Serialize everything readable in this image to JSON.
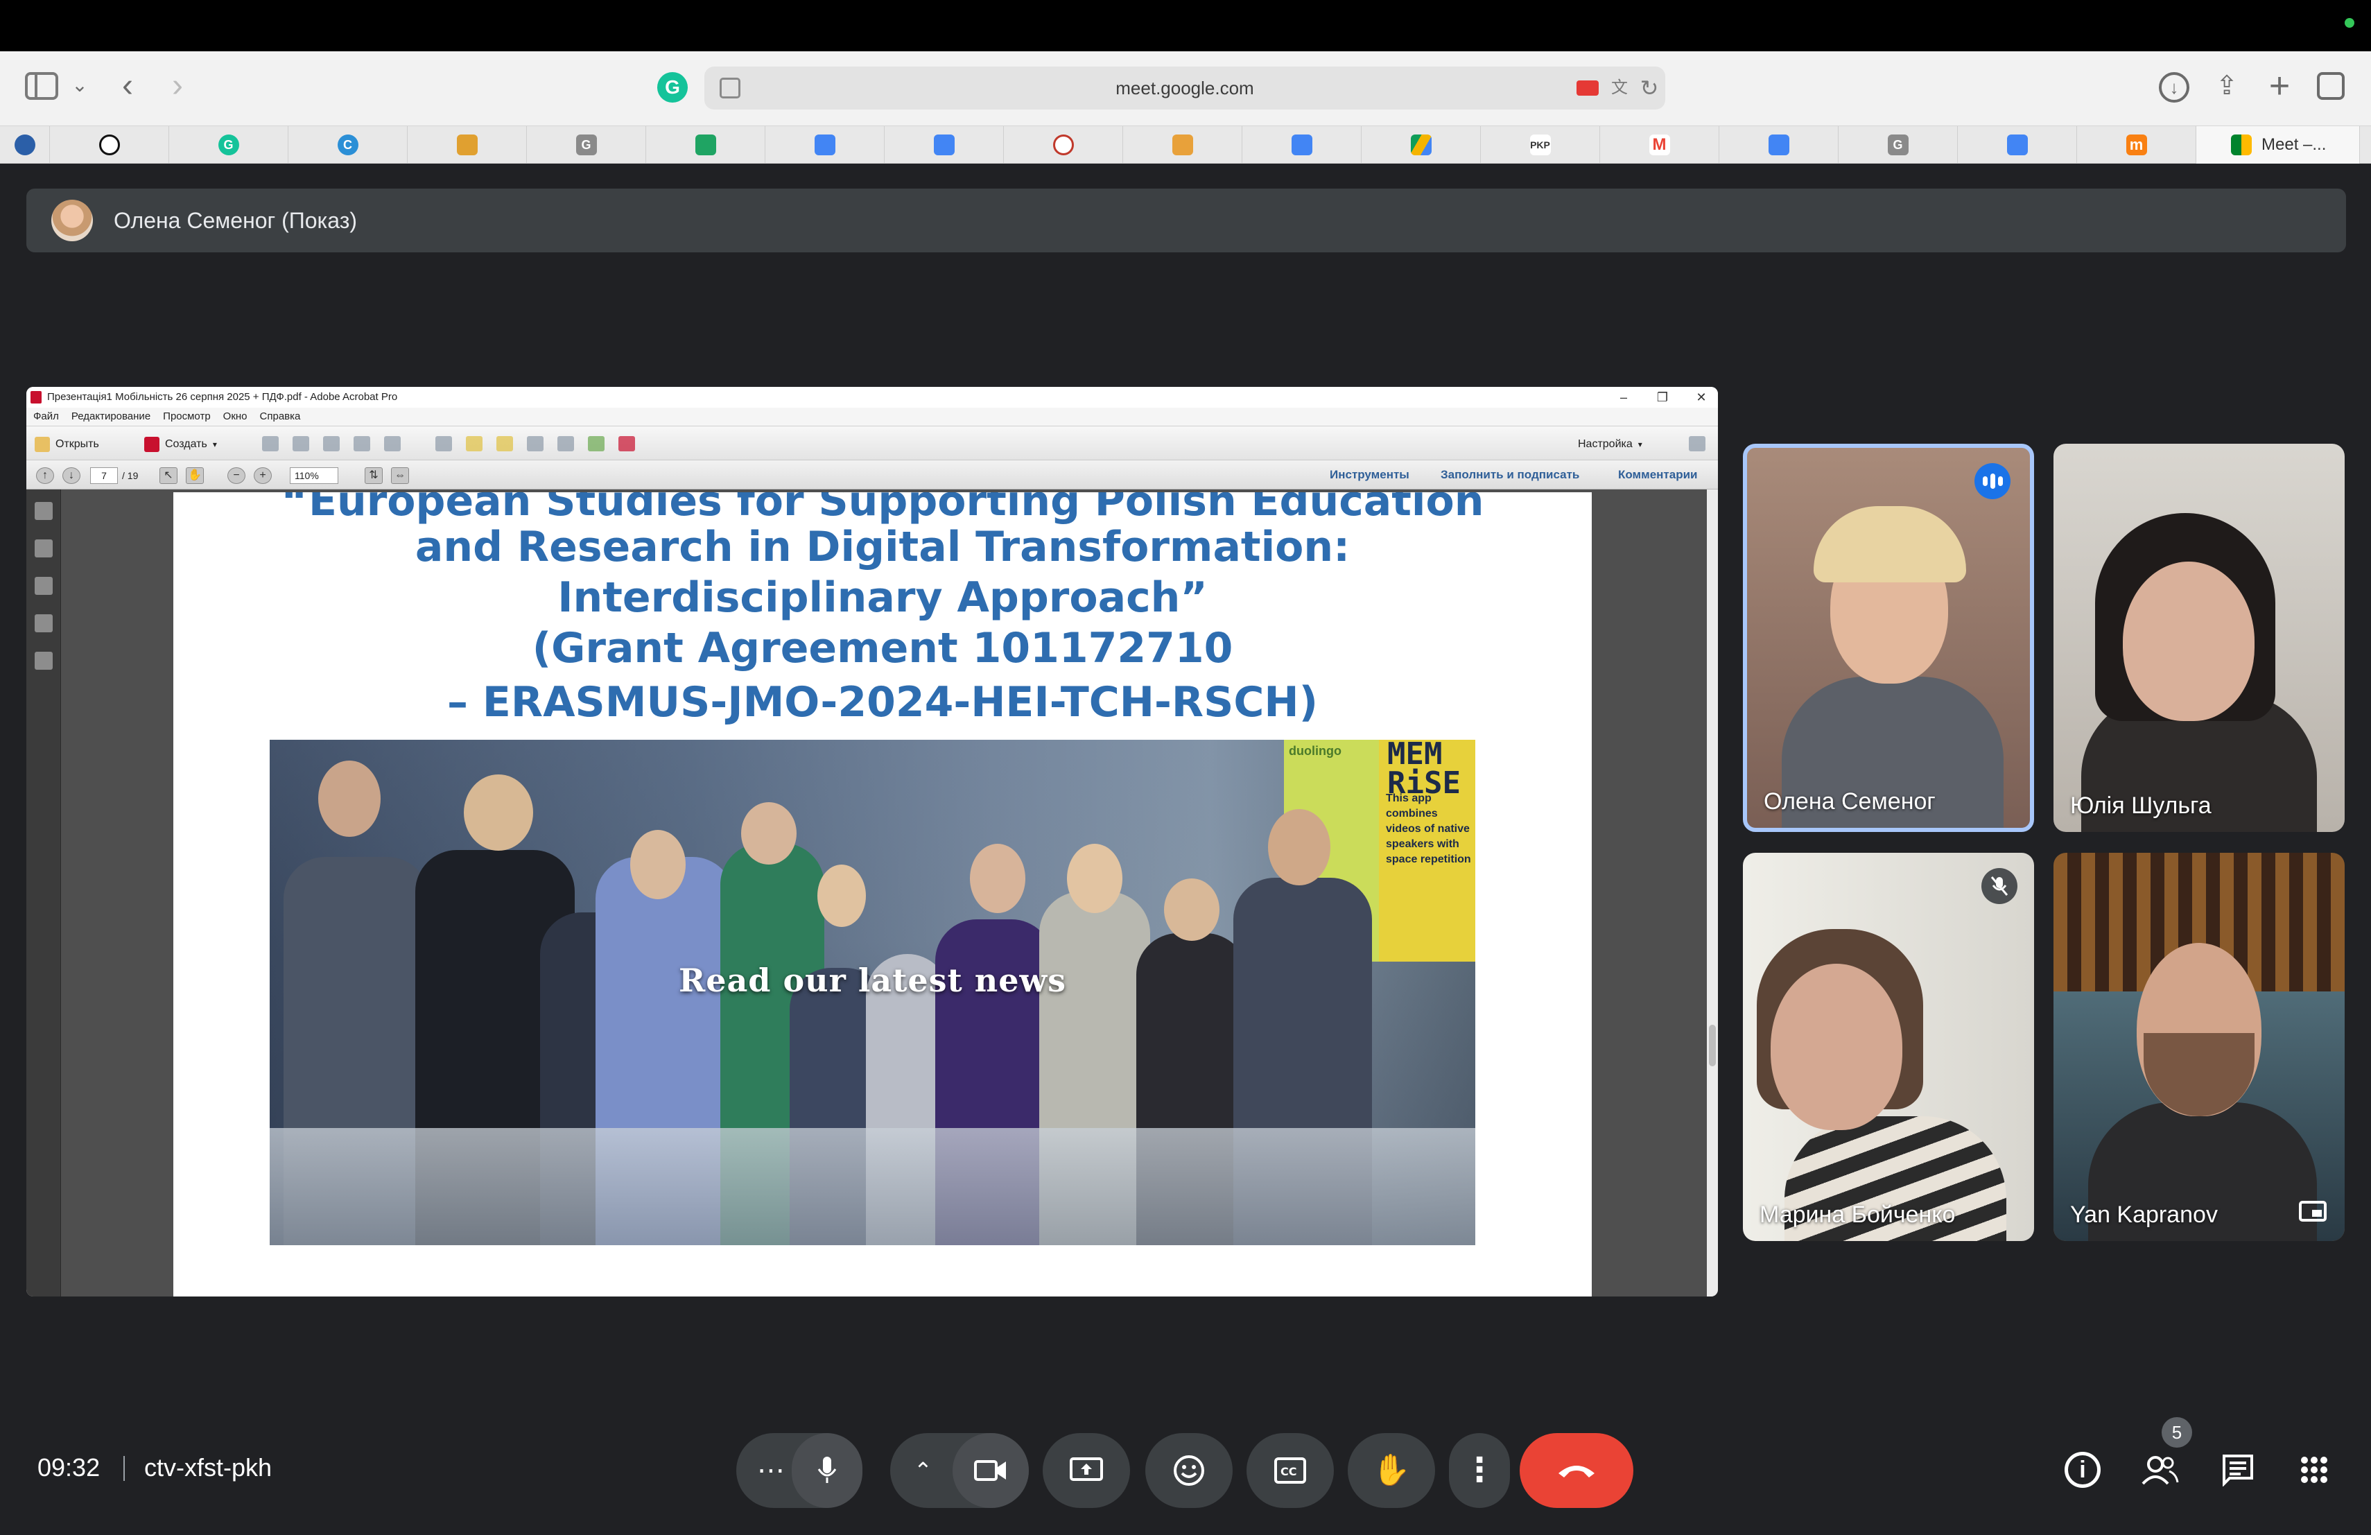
{
  "browser": {
    "url": "meet.google.com",
    "active_tab_title": "Meet –..."
  },
  "tabs": [
    {
      "icon": "globe-icon"
    },
    {
      "icon": "openai-icon"
    },
    {
      "icon": "grammarly-icon",
      "text": "G"
    },
    {
      "icon": "refresh-c-icon",
      "text": "C"
    },
    {
      "icon": "tool-icon"
    },
    {
      "icon": "google-g-icon",
      "text": "G"
    },
    {
      "icon": "google-sheets-icon"
    },
    {
      "icon": "google-docs-icon"
    },
    {
      "icon": "google-docs-icon"
    },
    {
      "icon": "site-icon"
    },
    {
      "icon": "puzzle-icon"
    },
    {
      "icon": "translate-icon"
    },
    {
      "icon": "google-drive-icon"
    },
    {
      "icon": "pkp-icon",
      "text": "PKP"
    },
    {
      "icon": "gmail-icon",
      "text": "M"
    },
    {
      "icon": "google-docs-icon"
    },
    {
      "icon": "google-g-icon",
      "text": "G"
    },
    {
      "icon": "google-docs-icon"
    },
    {
      "icon": "moodle-icon",
      "text": "m"
    }
  ],
  "presenter": {
    "label": "Олена Семеног (Показ)"
  },
  "acrobat": {
    "window_title": "Презентація1 Мобільність  26 серпня  2025 + ПДФ.pdf - Adobe Acrobat Pro",
    "menu": [
      "Файл",
      "Редактирование",
      "Просмотр",
      "Окно",
      "Справка"
    ],
    "toolbar": {
      "open_label": "Открыть",
      "create_label": "Создать",
      "customize_label": "Настройка"
    },
    "nav": {
      "page_current": "7",
      "page_total": "/ 19",
      "zoom": "110%",
      "tools_label": "Инструменты",
      "fill_sign_label": "Заполнить и подписать",
      "comments_label": "Комментарии"
    }
  },
  "slide": {
    "lines": [
      "“European Studies for Supporting Polish Education",
      "and Research in Digital Transformation:",
      "Interdisciplinary Approach”",
      "(Grant Agreement 101172710",
      "– ERASMUS-JMO-2024-HEI-TCH-RSCH)"
    ],
    "photo_caption": "Read our latest news",
    "poster_brand": "MEM RiSE",
    "poster_text": "This app combines videos of native speakers with space repetition",
    "poster_left_brand": "duolingo"
  },
  "participants": [
    {
      "name": "Олена Семеног",
      "speaking": true
    },
    {
      "name": "Юлія Шульга"
    },
    {
      "name": "Марина Бойченко",
      "muted": true
    },
    {
      "name": "Yan Kapranov"
    }
  ],
  "meeting": {
    "time": "09:32",
    "code": "ctv-xfst-pkh",
    "participant_count": "5"
  },
  "colors": {
    "meet_bg": "#202124",
    "end_call": "#ea4335",
    "slide_title": "#2e6db0",
    "active_speaker_border": "#a8c7fa"
  }
}
